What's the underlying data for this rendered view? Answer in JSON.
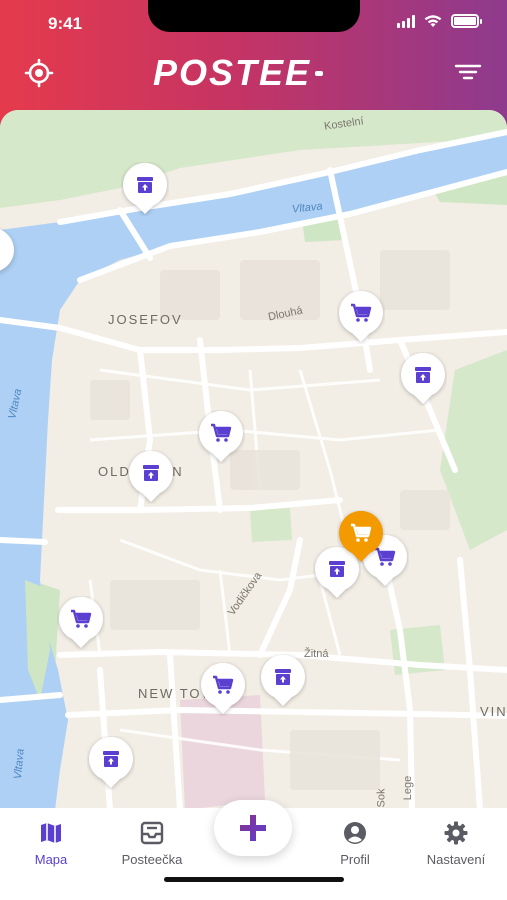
{
  "status_bar": {
    "time": "9:41"
  },
  "header": {
    "logo_text": "POSTEE"
  },
  "map": {
    "labels": {
      "kostelni": "Kostelní",
      "vltava_top": "Vltava",
      "josefov": "JOSEFOV",
      "dlouha": "Dlouhá",
      "vltava_left": "Vltava",
      "old_town": "OLD TOWN",
      "vodickova": "Vodičkova",
      "zitna": "Žitná",
      "new_town": "NEW TOWN",
      "vin": "VIN",
      "vltava_bottom": "Vltava",
      "legerova": "Lege",
      "sok": "Sok"
    }
  },
  "pins": [
    {
      "kind": "box",
      "color": "#5a3fd1",
      "bg": "#ffffff"
    },
    {
      "kind": "cart",
      "color": "#5a3fd1",
      "bg": "#ffffff"
    },
    {
      "kind": "box",
      "color": "#5a3fd1",
      "bg": "#ffffff"
    },
    {
      "kind": "cart",
      "color": "#5a3fd1",
      "bg": "#ffffff"
    },
    {
      "kind": "box",
      "color": "#5a3fd1",
      "bg": "#ffffff"
    },
    {
      "kind": "cart",
      "color": "#5a3fd1",
      "bg": "#ffffff"
    },
    {
      "kind": "box",
      "color": "#5a3fd1",
      "bg": "#ffffff"
    },
    {
      "kind": "cart",
      "color": "#ffffff",
      "bg": "#f29a00"
    },
    {
      "kind": "cart",
      "color": "#5a3fd1",
      "bg": "#ffffff"
    },
    {
      "kind": "box",
      "color": "#5a3fd1",
      "bg": "#ffffff"
    },
    {
      "kind": "cart",
      "color": "#5a3fd1",
      "bg": "#ffffff"
    },
    {
      "kind": "box",
      "color": "#5a3fd1",
      "bg": "#ffffff"
    }
  ],
  "tabbar": {
    "tabs": [
      {
        "label": "Mapa",
        "icon": "map-icon",
        "active": true
      },
      {
        "label": "Posteečka",
        "icon": "inbox-icon",
        "active": false
      },
      {
        "label": "Profil",
        "icon": "user-icon",
        "active": false
      },
      {
        "label": "Nastavení",
        "icon": "gear-icon",
        "active": false
      }
    ],
    "fab_icon": "plus-icon"
  },
  "colors": {
    "accent": "#5a3fd1",
    "header_start": "#e53a4c",
    "header_end": "#8e3a8e",
    "highlight_pin": "#f29a00",
    "water": "#aed0f4",
    "park": "#cfe6c4"
  }
}
